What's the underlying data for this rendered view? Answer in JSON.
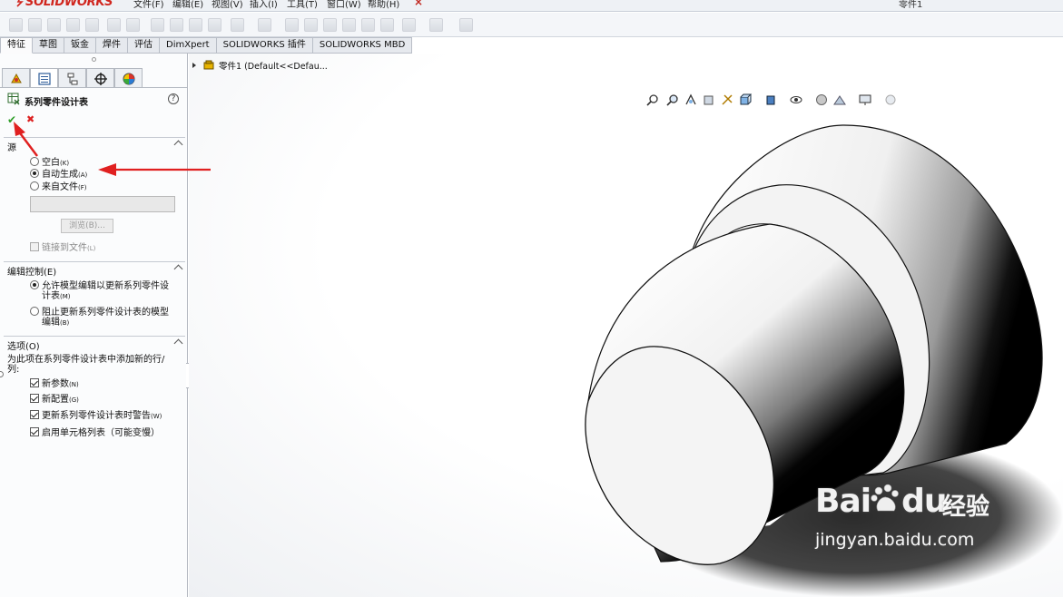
{
  "app": {
    "logo_text": "SOLIDWORKS",
    "top_right_text": "零件1"
  },
  "menu": {
    "items": [
      "文件(F)",
      "编辑(E)",
      "视图(V)",
      "插入(I)",
      "工具(T)",
      "窗口(W)",
      "帮助(H)"
    ]
  },
  "command_tabs": [
    "特征",
    "草图",
    "钣金",
    "焊件",
    "评估",
    "DimXpert",
    "SOLIDWORKS 插件",
    "SOLIDWORKS MBD"
  ],
  "property_manager": {
    "title": "系列零件设计表",
    "help_glyph": "?",
    "ok_glyph": "✔",
    "cancel_glyph": "✖",
    "source": {
      "title": "源",
      "options": [
        {
          "label": "空白",
          "key": "(K)",
          "selected": false
        },
        {
          "label": "自动生成",
          "key": "(A)",
          "selected": true
        },
        {
          "label": "来自文件",
          "key": "(F)",
          "selected": false
        }
      ],
      "file_path": "",
      "browse_label": "浏览(B)...",
      "link_label": "链接到文件",
      "link_key": "(L)"
    },
    "edit_control": {
      "title": "编辑控制(E)",
      "opt1_line1": "允许模型编辑以更新系列零件设",
      "opt1_line2": "计表",
      "opt1_key": "(M)",
      "opt2_line1": "阻止更新系列零件设计表的模型",
      "opt2_line2": "编辑",
      "opt2_key": "(B)",
      "selected": 0
    },
    "options": {
      "title": "选项(O)",
      "description_line1": "为此项在系列零件设计表中添加新的行/",
      "description_line2": "列:",
      "checks": [
        {
          "label": "新参数",
          "key": "(N)",
          "checked": true
        },
        {
          "label": "新配置",
          "key": "(G)",
          "checked": true
        },
        {
          "label": "更新系列零件设计表时警告",
          "key": "(W)",
          "checked": true
        },
        {
          "label": "启用单元格列表（可能变慢）",
          "key": "",
          "checked": true
        }
      ]
    }
  },
  "feature_tree": {
    "root_label": "零件1  (Default<<Defau..."
  },
  "watermark": {
    "brand": "Bai",
    "brand_suffix": "du",
    "cn": "经验",
    "url": "jingyan.baidu.com"
  },
  "colors": {
    "accent_red": "#d0261e",
    "ok_green": "#2e9e28",
    "arrow_red": "#e02020"
  }
}
